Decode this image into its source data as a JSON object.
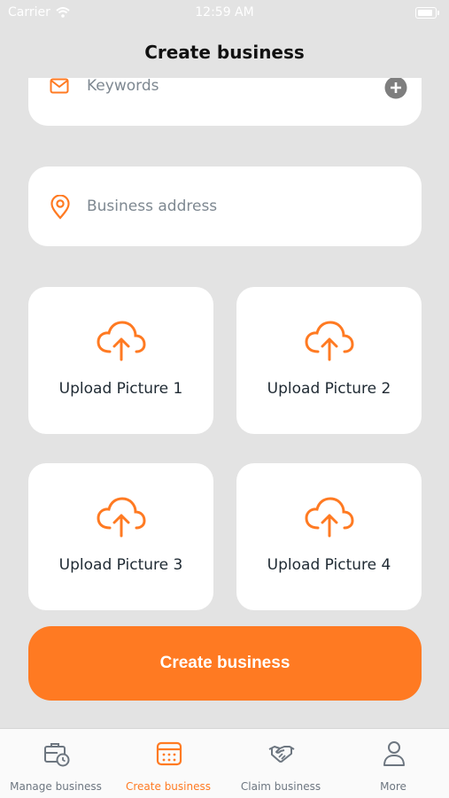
{
  "status_bar": {
    "carrier": "Carrier",
    "time": "12:59 AM"
  },
  "header": {
    "title": "Create business"
  },
  "form": {
    "keywords_placeholder": "Keywords",
    "address_placeholder": "Business address"
  },
  "uploads": [
    {
      "label": "Upload Picture 1"
    },
    {
      "label": "Upload Picture 2"
    },
    {
      "label": "Upload Picture 3"
    },
    {
      "label": "Upload Picture 4"
    }
  ],
  "submit": {
    "label": "Create business"
  },
  "tabs": [
    {
      "label": "Manage business",
      "icon": "briefcase-clock-icon",
      "active": false
    },
    {
      "label": "Create business",
      "icon": "calendar-icon",
      "active": true
    },
    {
      "label": "Claim business",
      "icon": "handshake-icon",
      "active": false
    },
    {
      "label": "More",
      "icon": "person-icon",
      "active": false
    }
  ],
  "colors": {
    "accent": "#ff7a22",
    "background": "#e3e3e3",
    "card": "#ffffff",
    "inactive_tab": "#6d7680"
  }
}
